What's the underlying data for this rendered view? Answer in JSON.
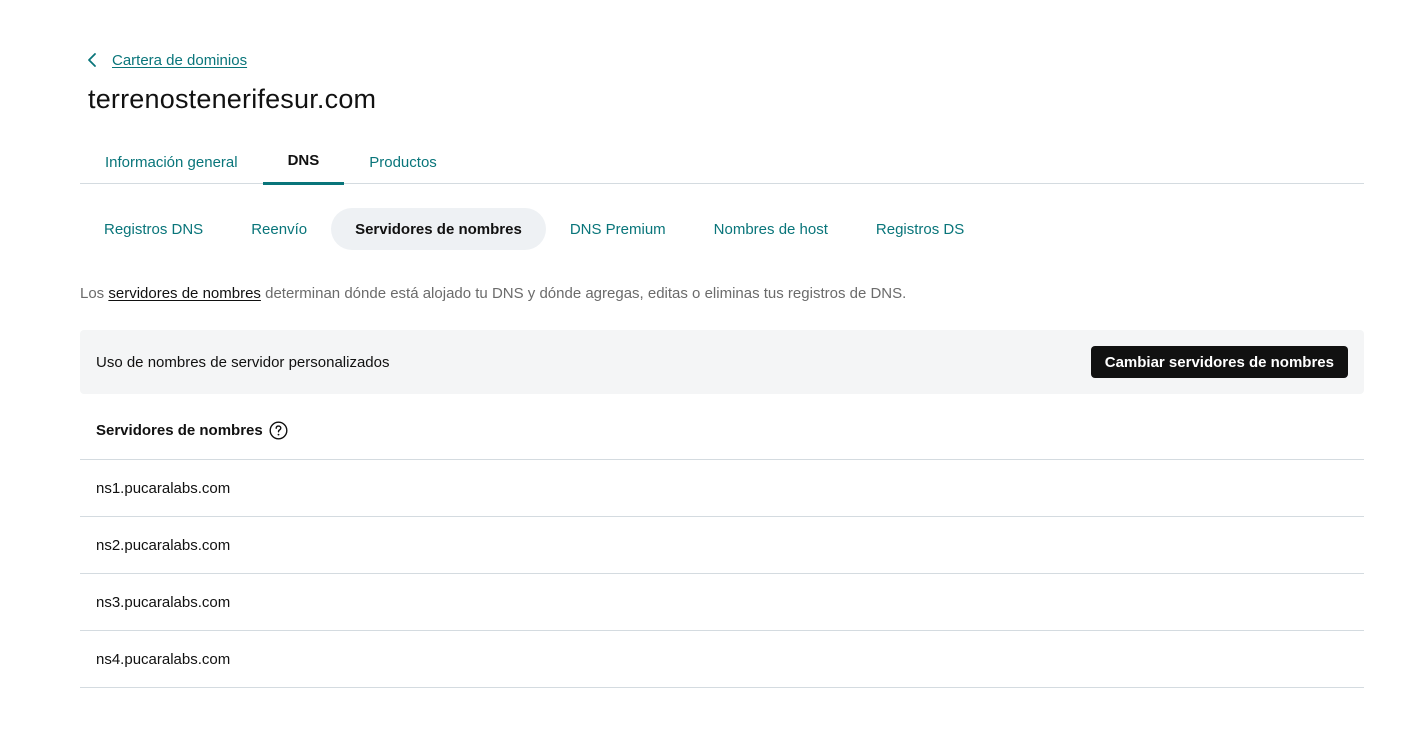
{
  "breadcrumb": {
    "label": "Cartera de dominios"
  },
  "domain": {
    "name": "terrenostenerifesur.com"
  },
  "main_tabs": [
    {
      "label": "Información general",
      "active": false
    },
    {
      "label": "DNS",
      "active": true
    },
    {
      "label": "Productos",
      "active": false
    }
  ],
  "sub_tabs": [
    {
      "label": "Registros DNS",
      "active": false
    },
    {
      "label": "Reenvío",
      "active": false
    },
    {
      "label": "Servidores de nombres",
      "active": true
    },
    {
      "label": "DNS Premium",
      "active": false
    },
    {
      "label": "Nombres de host",
      "active": false
    },
    {
      "label": "Registros DS",
      "active": false
    }
  ],
  "intro": {
    "prefix": "Los",
    "link": "servidores de nombres",
    "suffix": "determinan dónde está alojado tu DNS y dónde agregas, editas o eliminas tus registros de DNS."
  },
  "status_panel": {
    "label": "Uso de nombres de servidor personalizados",
    "button": "Cambiar servidores de nombres"
  },
  "nameservers": {
    "title": "Servidores de nombres",
    "help_icon": "question-circle-icon",
    "items": [
      "ns1.pucaralabs.com",
      "ns2.pucaralabs.com",
      "ns3.pucaralabs.com",
      "ns4.pucaralabs.com"
    ]
  },
  "colors": {
    "accent": "#09757a",
    "button_bg": "#111111",
    "panel_bg": "#f4f5f6",
    "divider": "#d4dbe0"
  }
}
